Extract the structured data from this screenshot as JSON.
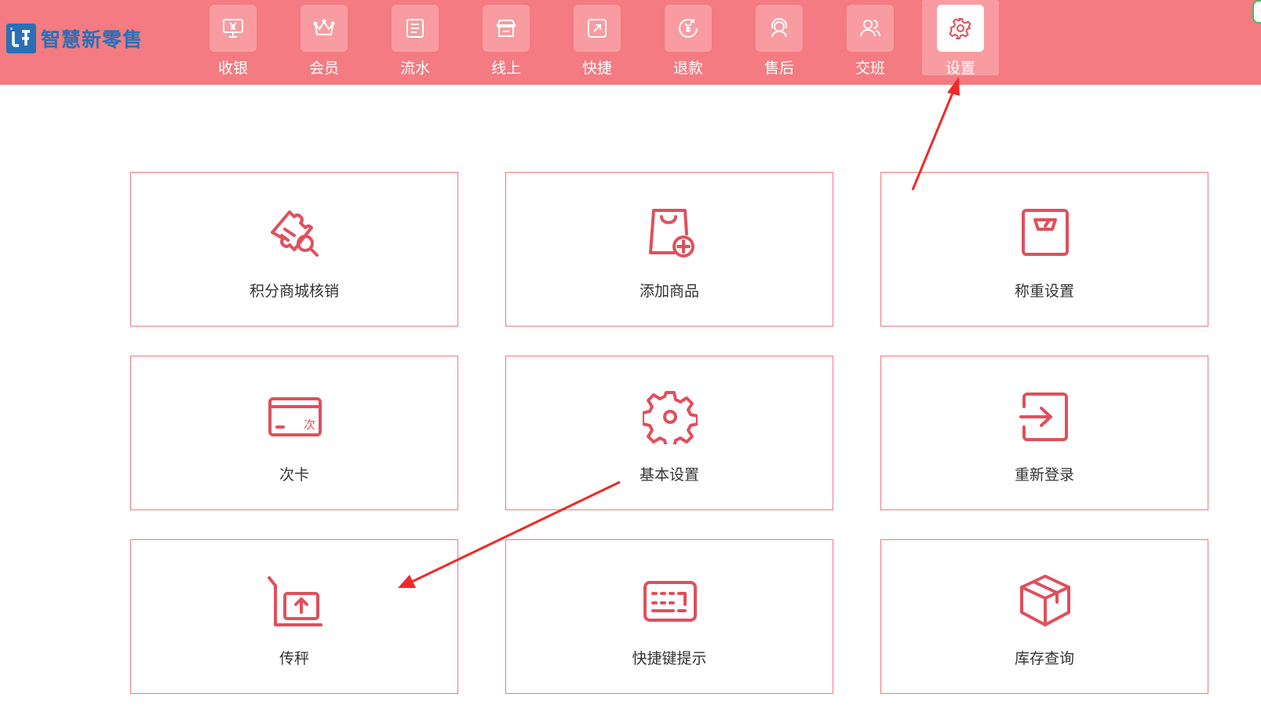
{
  "app": {
    "brand": "智慧新零售",
    "colors": {
      "header": "#f37b81",
      "tile_border": "#f07880",
      "icon": "#e0505c",
      "brand": "#2a6fb5"
    }
  },
  "nav": {
    "items": [
      {
        "label": "收银",
        "icon": "cash-register-icon"
      },
      {
        "label": "会员",
        "icon": "crown-icon"
      },
      {
        "label": "流水",
        "icon": "ledger-icon"
      },
      {
        "label": "线上",
        "icon": "storefront-icon"
      },
      {
        "label": "快捷",
        "icon": "shortcut-icon"
      },
      {
        "label": "退款",
        "icon": "refund-icon"
      },
      {
        "label": "售后",
        "icon": "headset-icon"
      },
      {
        "label": "交班",
        "icon": "users-icon"
      },
      {
        "label": "设置",
        "icon": "gear-icon"
      }
    ],
    "active": "设置"
  },
  "tiles": [
    {
      "label": "积分商城核销",
      "icon": "ticket-search-icon"
    },
    {
      "label": "添加商品",
      "icon": "bag-add-icon"
    },
    {
      "label": "称重设置",
      "icon": "scale-icon"
    },
    {
      "label": "次卡",
      "icon": "card-icon",
      "icon_text": "次"
    },
    {
      "label": "基本设置",
      "icon": "gear-icon"
    },
    {
      "label": "重新登录",
      "icon": "login-icon"
    },
    {
      "label": "传秤",
      "icon": "upload-scale-icon"
    },
    {
      "label": "快捷键提示",
      "icon": "keyboard-icon"
    },
    {
      "label": "库存查询",
      "icon": "box-icon"
    }
  ]
}
